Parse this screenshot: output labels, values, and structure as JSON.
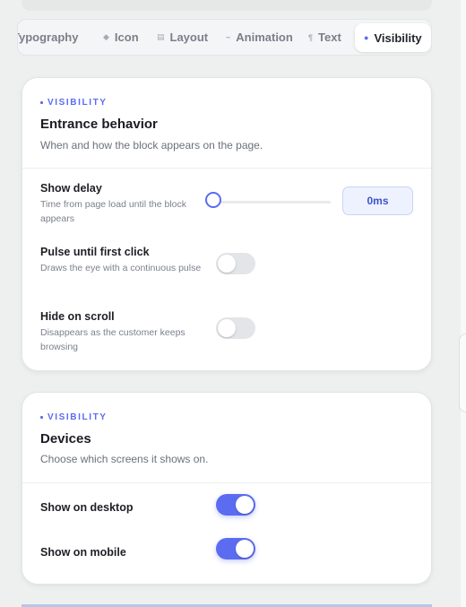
{
  "tabs": [
    {
      "label": "Typography",
      "glyph": "",
      "active": false
    },
    {
      "label": "Icon",
      "glyph": "◆",
      "active": false
    },
    {
      "label": "Layout",
      "glyph": "▤",
      "active": false
    },
    {
      "label": "Animation",
      "glyph": "~",
      "active": false
    },
    {
      "label": "Text",
      "glyph": "¶",
      "active": false
    },
    {
      "label": "Visibility",
      "glyph": "●",
      "active": true
    }
  ],
  "entrance": {
    "eyebrow": "VISIBILITY",
    "title": "Entrance behavior",
    "subtitle": "When and how the block appears on the page.",
    "show_delay": {
      "label": "Show delay",
      "desc": "Time from page load until the block appears",
      "value": "0ms",
      "slider_fraction": 0
    },
    "pulse": {
      "label": "Pulse until first click",
      "desc": "Draws the eye with a continuous pulse",
      "on": false
    },
    "hide_scroll": {
      "label": "Hide on scroll",
      "desc": "Disappears as the customer keeps browsing",
      "on": false
    }
  },
  "devices": {
    "eyebrow": "VISIBILITY",
    "title": "Devices",
    "subtitle": "Choose which screens it shows on.",
    "desktop": {
      "label": "Show on desktop",
      "on": true
    },
    "mobile": {
      "label": "Show on mobile",
      "on": true
    }
  },
  "colors": {
    "accent": "#5b6cf0",
    "toggle_off": "#e3e5e8"
  }
}
